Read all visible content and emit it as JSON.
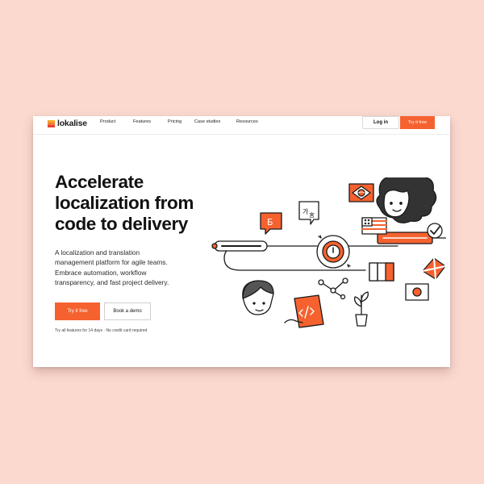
{
  "brand": {
    "name": "lokalise",
    "colors": {
      "accent": "#f5622f",
      "background": "#fbd9cf",
      "text": "#121212"
    }
  },
  "nav": {
    "links": [
      {
        "label": "Product"
      },
      {
        "label": "Features"
      },
      {
        "label": "Pricing"
      },
      {
        "label": "Case studies"
      },
      {
        "label": "Resources"
      }
    ],
    "login_label": "Log in",
    "try_label": "Try it free"
  },
  "hero": {
    "headline_lines": [
      "Accelerate",
      "localization from",
      "code to delivery"
    ],
    "subtext_lines": [
      "A localization and translation",
      "management platform for agile teams.",
      "Embrace automation, workflow",
      "transparency, and fast project delivery."
    ],
    "primary_cta": "Try it free",
    "secondary_cta": "Book a demo",
    "footnote": "Try all features for 14 days · No credit card required"
  },
  "illustration": {
    "cyrillic_glyph": "Б",
    "korean_glyph": "가",
    "cjk_glyph": "言",
    "icons": [
      "person-curly-hair",
      "person-short-hair",
      "flag-usa",
      "flag-france",
      "flag-japan",
      "flag-uk",
      "flag-brazil",
      "clock-sync",
      "code-tablet",
      "plant",
      "network-nodes",
      "checkmark"
    ]
  }
}
